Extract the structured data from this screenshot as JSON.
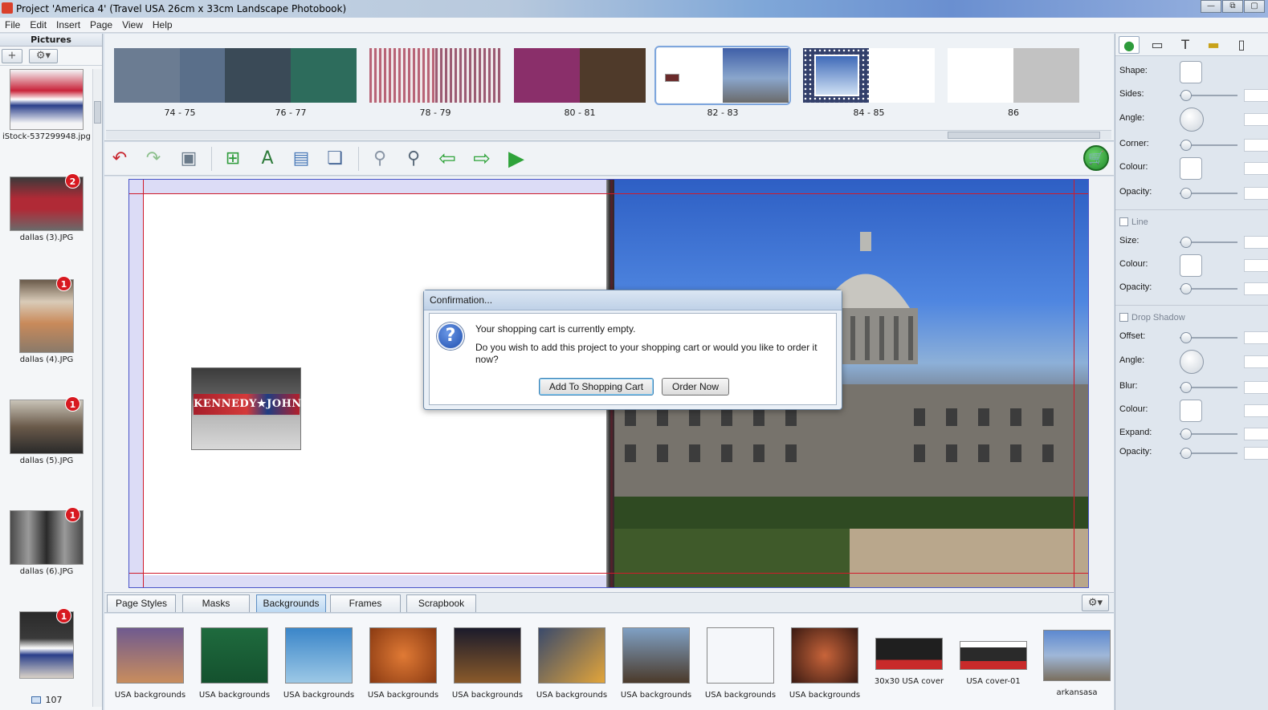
{
  "window": {
    "title": "Project 'America 4' (Travel USA 26cm x 33cm Landscape Photobook)",
    "buttons": [
      "—",
      "⧉",
      "▢"
    ]
  },
  "menu": [
    "File",
    "Edit",
    "Insert",
    "Page",
    "View",
    "Help"
  ],
  "sidebar": {
    "header": "Pictures",
    "add_button": "+",
    "options_button": "⚙▾",
    "pictures": [
      {
        "label": "iStock-537299948.jpg",
        "badge": ""
      },
      {
        "label": "dallas (3).JPG",
        "badge": "2"
      },
      {
        "label": "dallas (4).JPG",
        "badge": "1"
      },
      {
        "label": "dallas (5).JPG",
        "badge": "1"
      },
      {
        "label": "dallas (6).JPG",
        "badge": "1"
      },
      {
        "label": "",
        "badge": "1"
      }
    ],
    "count": "107"
  },
  "spreads": [
    {
      "label": "74 - 75",
      "colors": [
        "#6b7c92",
        "#5a6f8a"
      ]
    },
    {
      "label": "76 - 77",
      "colors": [
        "#3a4a57",
        "#2d6c5c"
      ]
    },
    {
      "label": "78 - 79",
      "colors": [
        "#b86477",
        "#9b5b73"
      ]
    },
    {
      "label": "80 - 81",
      "colors": [
        "#8a2f6a",
        "#4f3a2a"
      ]
    },
    {
      "label": "82 - 83",
      "colors": [
        "#ffffff",
        "#3f5fa8"
      ]
    },
    {
      "label": "84 - 85",
      "colors": [
        "#33406b",
        "#ffffff"
      ]
    },
    {
      "label": "86",
      "colors": [
        "#ffffff",
        "#c2c2c2"
      ]
    }
  ],
  "dialog": {
    "title": "Confirmation...",
    "message1": "Your shopping cart is currently empty.",
    "message2": "Do you wish to add this project to your shopping cart or would you like to order it now?",
    "add_button": "Add To Shopping Cart",
    "order_button": "Order Now"
  },
  "canvas": {
    "sign_text": "KENNEDY★JOHNSON"
  },
  "tabs": [
    "Page Styles",
    "Masks",
    "Backgrounds",
    "Frames",
    "Scrapbook"
  ],
  "active_tab": "Backgrounds",
  "gallery": [
    {
      "label": "USA backgrounds",
      "colors": [
        "#6f5a8f",
        "#c98d5d"
      ]
    },
    {
      "label": "USA backgrounds",
      "colors": [
        "#1f6b3e",
        "#14512e"
      ]
    },
    {
      "label": "USA backgrounds",
      "colors": [
        "#3b86c9",
        "#9cc8e6"
      ]
    },
    {
      "label": "USA backgrounds",
      "colors": [
        "#d06a2a",
        "#8a3a12"
      ]
    },
    {
      "label": "USA backgrounds",
      "colors": [
        "#1b1b2b",
        "#8a5a2a"
      ]
    },
    {
      "label": "USA backgrounds",
      "colors": [
        "#e3a53a",
        "#3a4a6b"
      ]
    },
    {
      "label": "USA backgrounds",
      "colors": [
        "#7fa0c4",
        "#4b3a2a"
      ]
    },
    {
      "label": "USA backgrounds",
      "colors": [
        "#2a3f8a",
        "#c82a2a"
      ]
    },
    {
      "label": "USA backgrounds",
      "colors": [
        "#3a1a12",
        "#c8643a"
      ]
    },
    {
      "label": "30x30 USA cover",
      "colors": [
        "#1f1f1f",
        "#c82a2a"
      ]
    },
    {
      "label": "USA cover-01",
      "colors": [
        "#ffffff",
        "#c82a2a"
      ]
    },
    {
      "label": "arkansasa",
      "colors": [
        "#5d89d0",
        "#7a6f5f"
      ]
    }
  ],
  "props": {
    "shape": "Shape:",
    "sides": "Sides:",
    "angle": "Angle:",
    "corner": "Corner:",
    "colour": "Colour:",
    "opacity": "Opacity:",
    "line_section": "Line",
    "size": "Size:",
    "drop_shadow_section": "Drop Shadow",
    "offset": "Offset:",
    "blur": "Blur:",
    "expand": "Expand:"
  },
  "colors": {
    "accent": "#7ea6dd",
    "guide": "#d01a2a",
    "badge": "#d71920"
  }
}
